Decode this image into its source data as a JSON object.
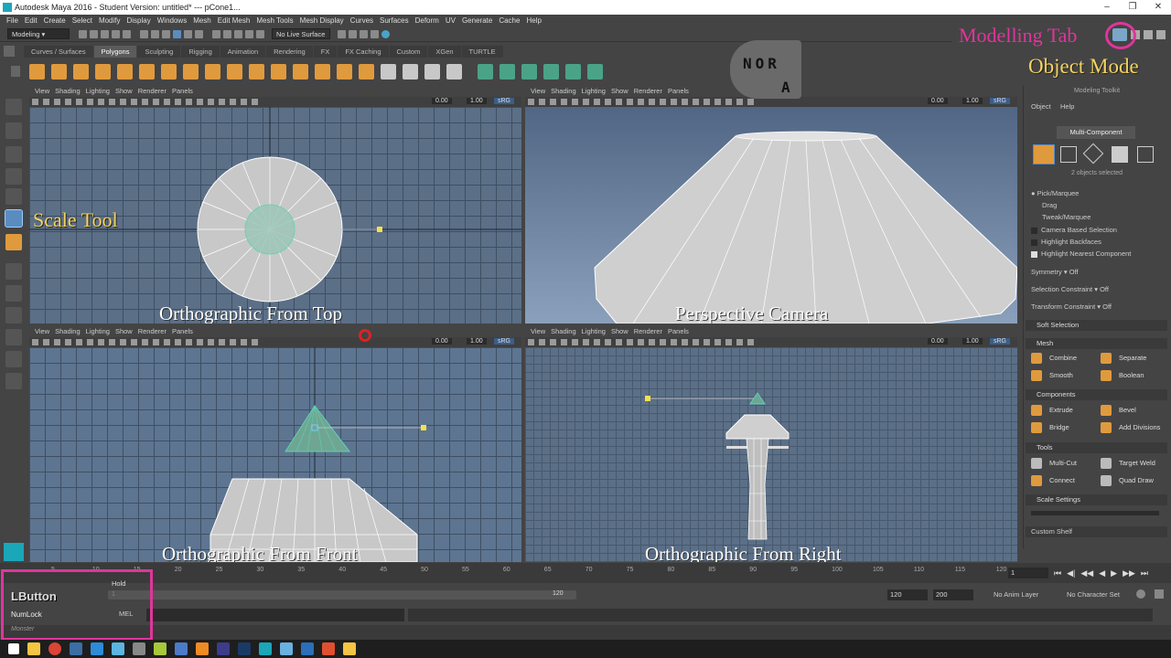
{
  "window": {
    "title": "Autodesk Maya 2016 - Student Version: untitled*   ---   pCone1..."
  },
  "menu": [
    "File",
    "Edit",
    "Create",
    "Select",
    "Modify",
    "Display",
    "Windows",
    "Mesh",
    "Edit Mesh",
    "Mesh Tools",
    "Mesh Display",
    "Curves",
    "Surfaces",
    "Deform",
    "UV",
    "Generate",
    "Cache",
    "Help"
  ],
  "statusline": {
    "mode": "Modeling",
    "live_surface": "No Live Surface"
  },
  "shelf": {
    "tabs": [
      "Curves / Surfaces",
      "Polygons",
      "Sculpting",
      "Rigging",
      "Animation",
      "Rendering",
      "FX",
      "FX Caching",
      "Custom",
      "XGen",
      "TURTLE"
    ],
    "active_tab": "Polygons"
  },
  "viewport_menu": [
    "View",
    "Shading",
    "Lighting",
    "Show",
    "Renderer",
    "Panels"
  ],
  "viewport_fields": {
    "exposure": "0.00",
    "gamma": "1.00",
    "color_space": "sRG"
  },
  "viewports": {
    "top": "Orthographic From Top",
    "persp": "Perspective Camera",
    "front": "Orthographic From Front",
    "right": "Orthographic From Right"
  },
  "overlays": {
    "modelling_tab": "Modelling Tab",
    "object_mode": "Object Mode",
    "scale_tool": "Scale Tool",
    "lbutton": "LButton",
    "numlock": "NumLock",
    "logo_text_1": "NOR",
    "logo_text_2": "A"
  },
  "panel": {
    "title": "Modeling Toolkit",
    "menu": [
      "Object",
      "Help"
    ],
    "multi_component": "Multi-Component",
    "selected_count": "2 objects selected",
    "options": [
      "Pick/Marquee",
      "Drag",
      "Tweak/Marquee"
    ],
    "checks": [
      {
        "label": "Camera Based Selection",
        "checked": false
      },
      {
        "label": "Highlight Backfaces",
        "checked": false
      },
      {
        "label": "Highlight Nearest Component",
        "checked": true
      }
    ],
    "symmetry": {
      "label": "Symmetry",
      "value": "Off"
    },
    "selection_constraint": {
      "label": "Selection Constraint",
      "value": "Off"
    },
    "transform_constraint": {
      "label": "Transform Constraint",
      "value": "Off"
    },
    "soft_selection": "Soft Selection",
    "mesh_section": "Mesh",
    "mesh_buttons": [
      "Combine",
      "Separate",
      "Smooth",
      "Boolean"
    ],
    "components_section": "Components",
    "component_buttons": [
      "Extrude",
      "Bevel",
      "Bridge",
      "Add Divisions"
    ],
    "tools_section": "Tools",
    "tool_buttons": [
      "Multi-Cut",
      "Target Weld",
      "Connect",
      "Quad Draw"
    ],
    "scale_settings": "Scale Settings",
    "custom_shelf": "Custom Shelf"
  },
  "timeline": {
    "ticks": [
      "5",
      "10",
      "15",
      "20",
      "25",
      "30",
      "35",
      "40",
      "45",
      "50",
      "55",
      "60",
      "65",
      "70",
      "75",
      "80",
      "85",
      "90",
      "95",
      "100",
      "105",
      "110",
      "115",
      "120"
    ],
    "current": "1",
    "hold": "Hold"
  },
  "range": {
    "start": "1",
    "range_end": "120",
    "end": "120",
    "max": "200",
    "anim_layer": "No Anim Layer",
    "char_set": "No Character Set"
  },
  "cmd": {
    "label": "MEL"
  },
  "help": {
    "text": "Monster"
  }
}
